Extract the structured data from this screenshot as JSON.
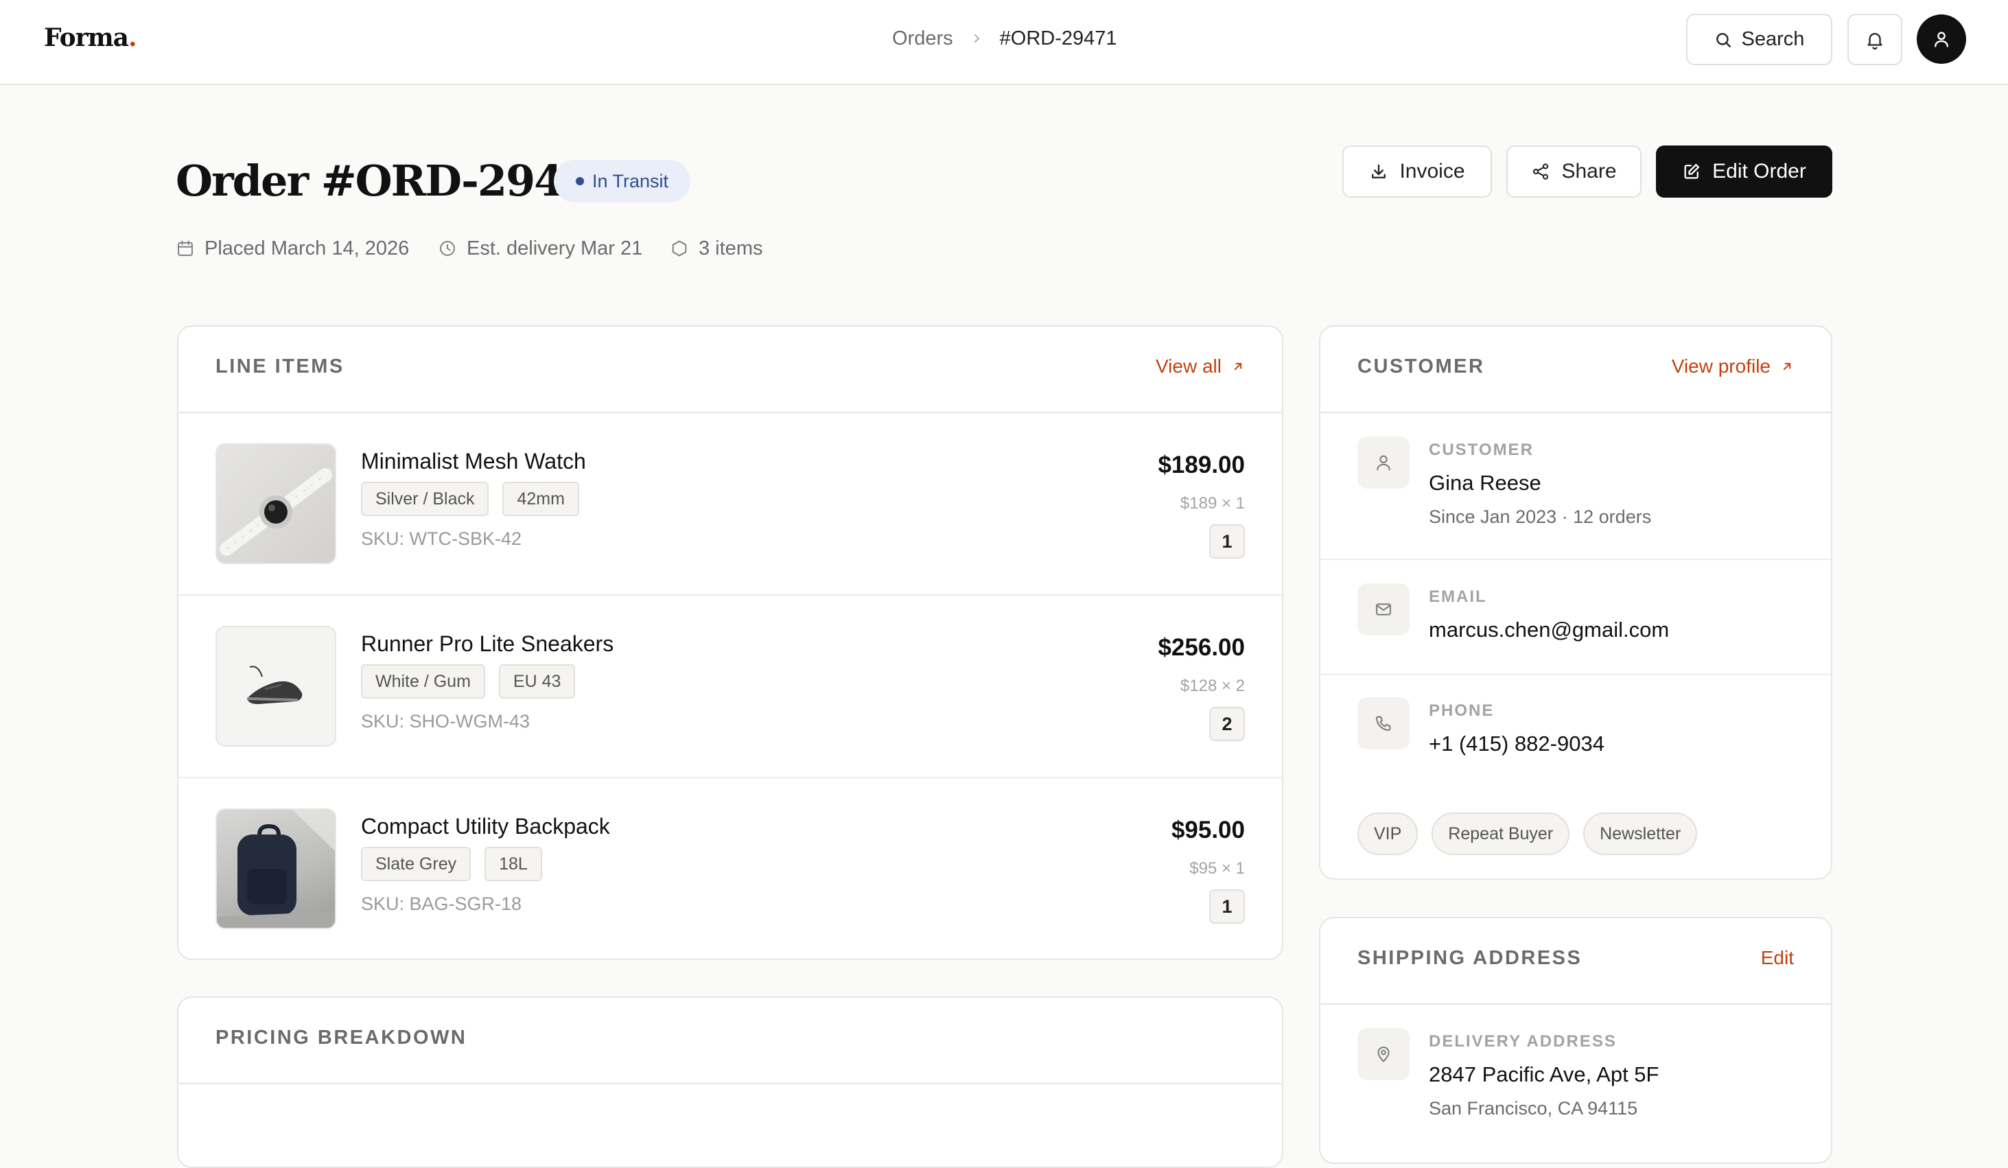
{
  "brand": {
    "name": "Forma",
    "dot": ".",
    "accent": "#c2410c"
  },
  "breadcrumb": {
    "parent": "Orders",
    "current": "#ORD-29471"
  },
  "topbar": {
    "search_label": "Search",
    "icons": [
      "search-icon",
      "bell-icon",
      "user-icon"
    ]
  },
  "order": {
    "title": "Order #ORD-29471",
    "status": "In Transit",
    "placed": "Placed March 14, 2026",
    "delivery": "Est. delivery Mar 21",
    "items_count": "3 items"
  },
  "actions": {
    "invoice": "Invoice",
    "share": "Share",
    "edit": "Edit Order"
  },
  "line_items": {
    "title": "LINE ITEMS",
    "view_all": "View all",
    "items": [
      {
        "name": "Minimalist Mesh Watch",
        "options": [
          "Silver / Black",
          "42mm"
        ],
        "sku": "SKU: WTC-SBK-42",
        "total": "$189.00",
        "unit": "$189 × 1",
        "qty": "1"
      },
      {
        "name": "Runner Pro Lite Sneakers",
        "options": [
          "White / Gum",
          "EU 43"
        ],
        "sku": "SKU: SHO-WGM-43",
        "total": "$256.00",
        "unit": "$128 × 2",
        "qty": "2"
      },
      {
        "name": "Compact Utility Backpack",
        "options": [
          "Slate Grey",
          "18L"
        ],
        "sku": "SKU: BAG-SGR-18",
        "total": "$95.00",
        "unit": "$95 × 1",
        "qty": "1"
      }
    ]
  },
  "pricing": {
    "title": "PRICING BREAKDOWN"
  },
  "customer": {
    "title": "CUSTOMER",
    "view_profile": "View profile",
    "customer_label": "CUSTOMER",
    "name": "Gina Reese",
    "since": "Since Jan 2023 · 12 orders",
    "email_label": "EMAIL",
    "email": "marcus.chen@gmail.com",
    "phone_label": "PHONE",
    "phone": "+1 (415) 882-9034",
    "tags": [
      "VIP",
      "Repeat Buyer",
      "Newsletter"
    ]
  },
  "shipping": {
    "title": "SHIPPING ADDRESS",
    "edit": "Edit",
    "label": "DELIVERY ADDRESS",
    "line1": "2847 Pacific Ave, Apt 5F",
    "line2": "San Francisco, CA 94115"
  }
}
